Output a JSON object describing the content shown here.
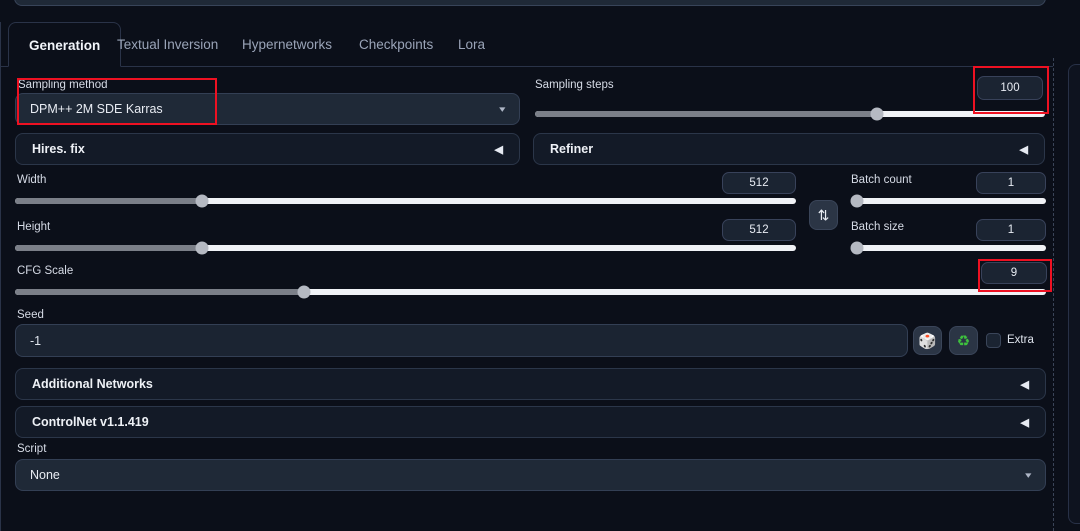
{
  "tabs": [
    {
      "label": "Generation",
      "active": true
    },
    {
      "label": "Textual Inversion",
      "active": false
    },
    {
      "label": "Hypernetworks",
      "active": false
    },
    {
      "label": "Checkpoints",
      "active": false
    },
    {
      "label": "Lora",
      "active": false
    }
  ],
  "sampling": {
    "method_label": "Sampling method",
    "method_value": "DPM++ 2M SDE Karras",
    "steps_label": "Sampling steps",
    "steps_value": "100",
    "steps_percent": 67
  },
  "accordions": {
    "hires_fix": "Hires. fix",
    "refiner": "Refiner",
    "additional_networks": "Additional Networks",
    "controlnet": "ControlNet v1.1.419",
    "collapse_glyph": "◀"
  },
  "dimensions": {
    "width_label": "Width",
    "width_value": "512",
    "width_percent": 24,
    "height_label": "Height",
    "height_value": "512",
    "height_percent": 24,
    "swap_glyph": "⇅"
  },
  "batch": {
    "count_label": "Batch count",
    "count_value": "1",
    "count_percent": 2,
    "size_label": "Batch size",
    "size_value": "1",
    "size_percent": 2
  },
  "cfg": {
    "label": "CFG Scale",
    "value": "9",
    "percent": 28
  },
  "seed": {
    "label": "Seed",
    "value": "-1",
    "dice_glyph": "🎲",
    "recycle_glyph": "♻",
    "extra_label": "Extra",
    "extra_checked": false
  },
  "script": {
    "label": "Script",
    "value": "None",
    "caret_glyph": "▾"
  },
  "dropdown_caret": "▾",
  "colors": {
    "background": "#0b0f19",
    "panel_border": "#2a3348",
    "input_bg": "#1f2937",
    "slider_track": "#f0f2f6",
    "slider_fill": "#7b7f88",
    "highlight_red": "#ee1122",
    "recycle_green": "#3ec13e",
    "text_primary": "#eef1f6",
    "text_muted": "#9aa4b8"
  }
}
